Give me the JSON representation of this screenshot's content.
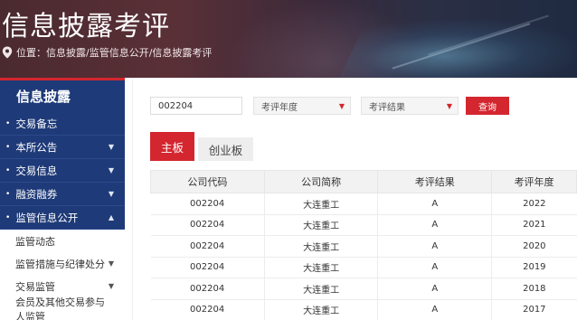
{
  "header": {
    "title": "信息披露考评",
    "breadcrumb": "位置：信息披露/监管信息公开/信息披露考评",
    "pin_icon": "location-pin-icon"
  },
  "sidebar": {
    "heading": "信息披露",
    "items": [
      {
        "label": "交易备忘",
        "has_caret": false
      },
      {
        "label": "本所公告",
        "has_caret": true
      },
      {
        "label": "交易信息",
        "has_caret": true
      },
      {
        "label": "融资融券",
        "has_caret": true
      },
      {
        "label": "监管信息公开",
        "has_caret": true,
        "expanded": true
      }
    ],
    "sub_items": [
      {
        "label": "监管动态",
        "has_caret": false
      },
      {
        "label": "监管措施与纪律处分",
        "has_caret": true
      },
      {
        "label": "交易监管",
        "has_caret": true
      },
      {
        "label": "会员及其他交易参与人监管",
        "has_caret": false
      }
    ]
  },
  "filters": {
    "code_value": "002204",
    "year_select": "考评年度",
    "result_select": "考评结果",
    "search_label": "查询"
  },
  "tabs": [
    {
      "label": "主板",
      "active": true
    },
    {
      "label": "创业板",
      "active": false
    }
  ],
  "table": {
    "columns": [
      "公司代码",
      "公司简称",
      "考评结果",
      "考评年度"
    ],
    "rows": [
      [
        "002204",
        "大连重工",
        "A",
        "2022"
      ],
      [
        "002204",
        "大连重工",
        "A",
        "2021"
      ],
      [
        "002204",
        "大连重工",
        "A",
        "2020"
      ],
      [
        "002204",
        "大连重工",
        "A",
        "2019"
      ],
      [
        "002204",
        "大连重工",
        "A",
        "2018"
      ],
      [
        "002204",
        "大连重工",
        "A",
        "2017"
      ]
    ]
  },
  "colors": {
    "brand_red": "#d4262f",
    "sidebar_blue": "#1e3a78"
  }
}
